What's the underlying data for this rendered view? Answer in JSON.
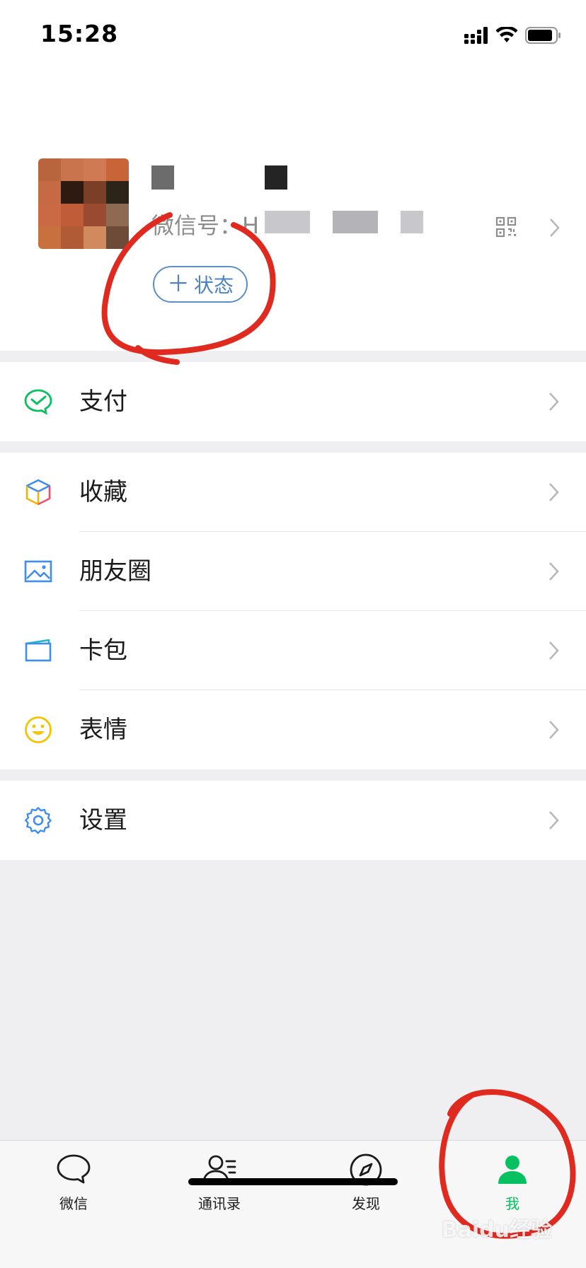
{
  "status_bar": {
    "time": "15:28"
  },
  "profile": {
    "wechat_id_label": "微信号：H",
    "status_button_label": "状态"
  },
  "menu": {
    "pay": {
      "label": "支付",
      "icon": "pay-icon"
    },
    "favorites": {
      "label": "收藏",
      "icon": "favorites-cube-icon"
    },
    "moments": {
      "label": "朋友圈",
      "icon": "moments-picture-icon"
    },
    "cards": {
      "label": "卡包",
      "icon": "card-wallet-icon"
    },
    "stickers": {
      "label": "表情",
      "icon": "smiley-icon"
    },
    "settings": {
      "label": "设置",
      "icon": "gear-icon"
    }
  },
  "tabbar": {
    "tabs": [
      {
        "label": "微信",
        "icon": "chat-bubble-icon"
      },
      {
        "label": "通讯录",
        "icon": "contacts-icon"
      },
      {
        "label": "发现",
        "icon": "compass-icon"
      },
      {
        "label": "我",
        "icon": "person-icon",
        "active": true
      }
    ]
  },
  "watermark": "Baidu经验",
  "colors": {
    "accent_green": "#07C160",
    "link_blue": "#4e84c4",
    "annotation_red": "#e02a20"
  }
}
